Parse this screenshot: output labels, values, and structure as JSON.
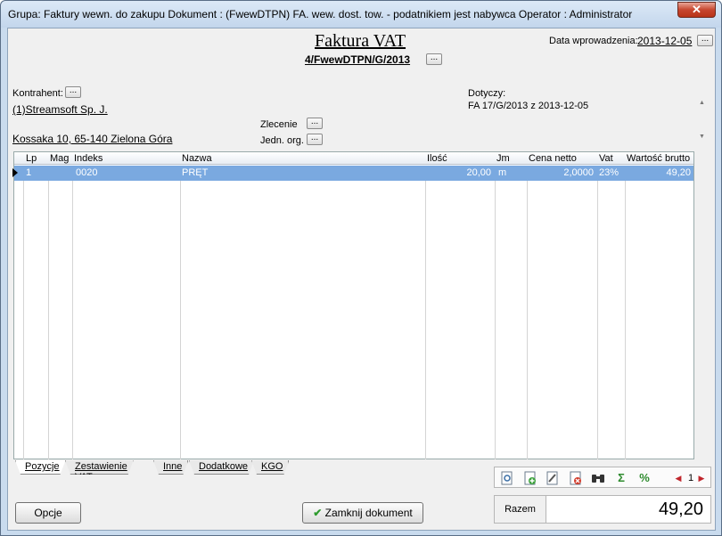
{
  "window": {
    "title": "Grupa: Faktury wewn. do zakupu    Dokument : (FwewDTPN) FA. wew. dost. tow. - podatnikiem jest nabywca    Operator : Administrator",
    "close_label": "✕"
  },
  "document": {
    "title": "Faktura VAT",
    "number": "4/FwewDTPN/G/2013",
    "date_label": "Data wprowadzenia:",
    "date_value": "2013-12-05",
    "dots": "..."
  },
  "contractor": {
    "label": "Kontrahent:",
    "name": "(1)Streamsoft Sp. J.",
    "address": "Kossaka 10, 65-140 Zielona Góra"
  },
  "order": {
    "label": "Zlecenie"
  },
  "org_unit": {
    "label": "Jedn. org."
  },
  "concerns": {
    "label": "Dotyczy:",
    "value": "FA 17/G/2013 z 2013-12-05"
  },
  "grid": {
    "columns": {
      "lp": "Lp",
      "mag": "Mag",
      "indeks": "Indeks",
      "nazwa": "Nazwa",
      "ilosc": "Ilość",
      "jm": "Jm",
      "cena": "Cena netto",
      "vat": "Vat",
      "wartosc": "Wartość brutto"
    },
    "rows": [
      {
        "lp": "1",
        "mag": "",
        "indeks": "0020",
        "nazwa": "PRĘT",
        "ilosc": "20,00",
        "jm": "m",
        "cena": "2,0000",
        "vat": "23%",
        "wartosc": "49,20"
      }
    ]
  },
  "tabs": [
    "Pozycje",
    "Zestawienie VAT",
    "Inne",
    "Dodatkowe",
    "KGO"
  ],
  "toolbar": {
    "page": "1",
    "sigma": "Σ",
    "percent": "%"
  },
  "buttons": {
    "options": "Opcje",
    "close_document": "Zamknij dokument"
  },
  "total": {
    "label": "Razem",
    "value": "49,20"
  },
  "colors": {
    "selected_row": "#7aa9e0",
    "window_frame": "#c9dbee",
    "close_button": "#c7462f"
  }
}
